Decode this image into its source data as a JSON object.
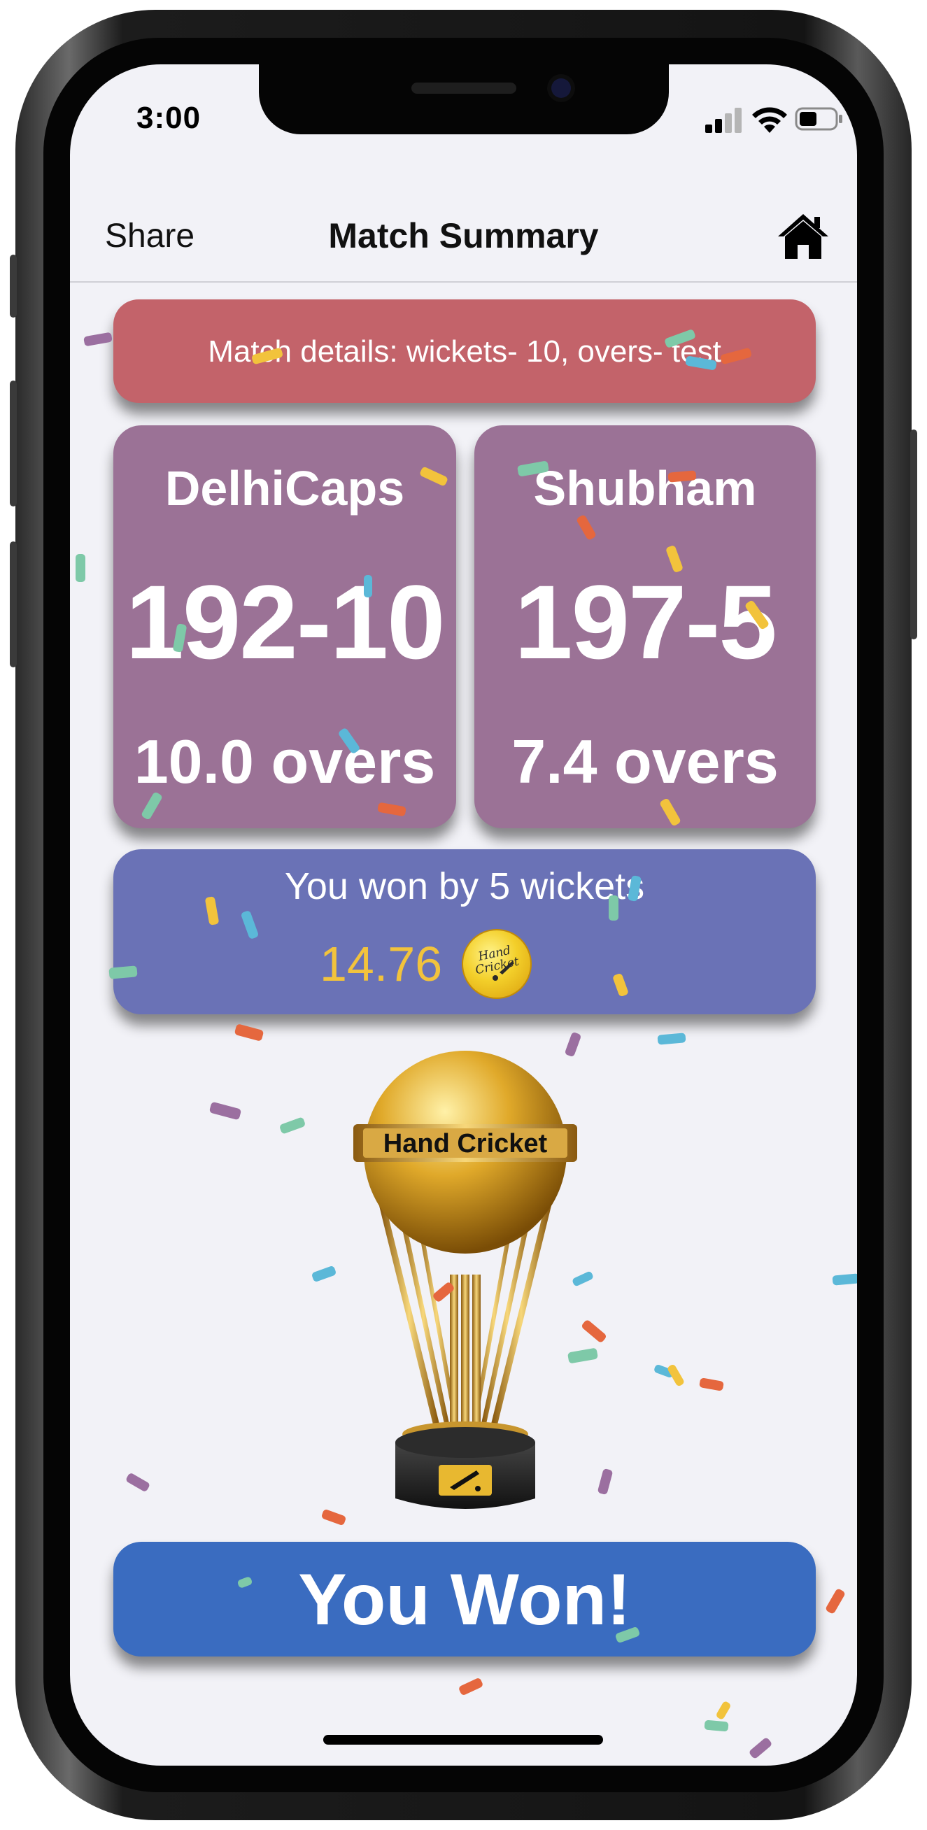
{
  "status_bar": {
    "time": "3:00"
  },
  "nav": {
    "share_label": "Share",
    "title": "Match Summary",
    "home_icon": "home-icon"
  },
  "match": {
    "details": "Match details: wickets- 10, overs- test",
    "teams": [
      {
        "name": "DelhiCaps",
        "score": "192-10",
        "overs": "10.0 overs"
      },
      {
        "name": "Shubham",
        "score": "197-5",
        "overs": "7.4 overs"
      }
    ],
    "result": "You won by 5 wickets",
    "coins": "14.76"
  },
  "trophy": {
    "label": "Hand Cricket"
  },
  "coin_logo_text": "Hand Cricket",
  "won_button": {
    "label": "You Won!"
  },
  "colors": {
    "details_card": "#c3636a",
    "team_card": "#9b7296",
    "result_card": "#6a72b6",
    "won_button": "#3a6cc0",
    "coin_text": "#f2c33c"
  }
}
